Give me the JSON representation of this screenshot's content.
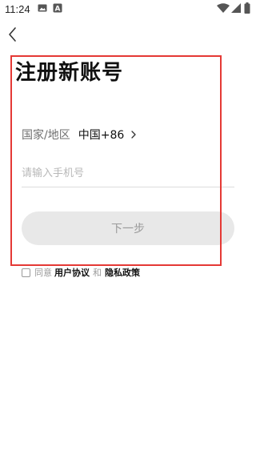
{
  "status_bar": {
    "time": "11:24",
    "icons": [
      "gallery-icon",
      "a-icon",
      "wifi-icon",
      "signal-icon",
      "battery-icon"
    ]
  },
  "header": {
    "back_icon": "chevron-left-icon",
    "title": "注册新账号"
  },
  "form": {
    "region_label": "国家/地区",
    "region_value": "中国+86",
    "region_chevron": "chevron-right-icon",
    "phone_placeholder": "请输入手机号",
    "phone_value": "",
    "next_button_label": "下一步",
    "next_button_enabled": false
  },
  "agreement": {
    "checked": false,
    "prefix": "同意",
    "user_agreement": "用户协议",
    "and": "和",
    "privacy_policy": "隐私政策"
  },
  "colors": {
    "highlight_frame": "#e53935",
    "button_disabled_bg": "#e8e8e8",
    "button_disabled_text": "#9a9a9a",
    "placeholder": "#b8b8b8",
    "secondary_text": "#6f6f6f"
  }
}
